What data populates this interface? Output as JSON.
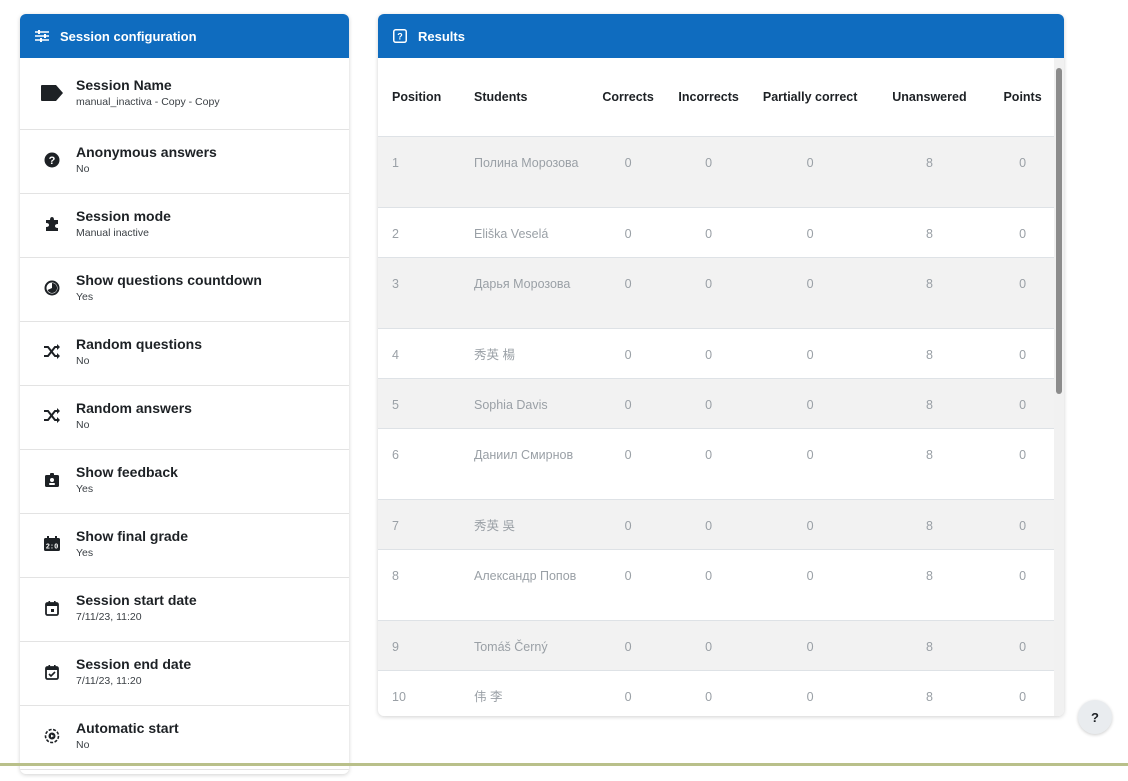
{
  "config": {
    "header": "Session configuration",
    "items": [
      {
        "title": "Session Name",
        "value": "manual_inactiva - Copy - Copy",
        "icon": "tag-icon"
      },
      {
        "title": "Anonymous answers",
        "value": "No",
        "icon": "question-circle-icon"
      },
      {
        "title": "Session mode",
        "value": "Manual inactive",
        "icon": "puzzle-icon"
      },
      {
        "title": "Show questions countdown",
        "value": "Yes",
        "icon": "countdown-icon"
      },
      {
        "title": "Random questions",
        "value": "No",
        "icon": "shuffle-icon"
      },
      {
        "title": "Random answers",
        "value": "No",
        "icon": "shuffle-icon"
      },
      {
        "title": "Show feedback",
        "value": "Yes",
        "icon": "id-badge-icon"
      },
      {
        "title": "Show final grade",
        "value": "Yes",
        "icon": "scoreboard-icon"
      },
      {
        "title": "Session start date",
        "value": "7/11/23, 11:20",
        "icon": "calendar-icon"
      },
      {
        "title": "Session end date",
        "value": "7/11/23, 11:20",
        "icon": "calendar-check-icon"
      },
      {
        "title": "Automatic start",
        "value": "No",
        "icon": "auto-start-icon"
      }
    ]
  },
  "results": {
    "header": "Results",
    "columns": {
      "position": "Position",
      "students": "Students",
      "corrects": "Corrects",
      "incorrects": "Incorrects",
      "partial": "Partially correct",
      "unanswered": "Unanswered",
      "points": "Points"
    },
    "rows": [
      {
        "position": "1",
        "student": "Полина Морозова",
        "corrects": "0",
        "incorrects": "0",
        "partial": "0",
        "unanswered": "8",
        "points": "0"
      },
      {
        "position": "2",
        "student": "Eliška Veselá",
        "corrects": "0",
        "incorrects": "0",
        "partial": "0",
        "unanswered": "8",
        "points": "0"
      },
      {
        "position": "3",
        "student": "Дарья Морозова",
        "corrects": "0",
        "incorrects": "0",
        "partial": "0",
        "unanswered": "8",
        "points": "0"
      },
      {
        "position": "4",
        "student": "秀英 楊",
        "corrects": "0",
        "incorrects": "0",
        "partial": "0",
        "unanswered": "8",
        "points": "0"
      },
      {
        "position": "5",
        "student": "Sophia Davis",
        "corrects": "0",
        "incorrects": "0",
        "partial": "0",
        "unanswered": "8",
        "points": "0"
      },
      {
        "position": "6",
        "student": "Даниил Смирнов",
        "corrects": "0",
        "incorrects": "0",
        "partial": "0",
        "unanswered": "8",
        "points": "0"
      },
      {
        "position": "7",
        "student": "秀英 吳",
        "corrects": "0",
        "incorrects": "0",
        "partial": "0",
        "unanswered": "8",
        "points": "0"
      },
      {
        "position": "8",
        "student": "Александр Попов",
        "corrects": "0",
        "incorrects": "0",
        "partial": "0",
        "unanswered": "8",
        "points": "0"
      },
      {
        "position": "9",
        "student": "Tomáš Černý",
        "corrects": "0",
        "incorrects": "0",
        "partial": "0",
        "unanswered": "8",
        "points": "0"
      },
      {
        "position": "10",
        "student": "伟 李",
        "corrects": "0",
        "incorrects": "0",
        "partial": "0",
        "unanswered": "8",
        "points": "0"
      }
    ]
  },
  "help": {
    "label": "?"
  },
  "colors": {
    "brand": "#0f6cbf",
    "stripe": "#f2f2f2",
    "muted_text": "#9aa0a6"
  }
}
